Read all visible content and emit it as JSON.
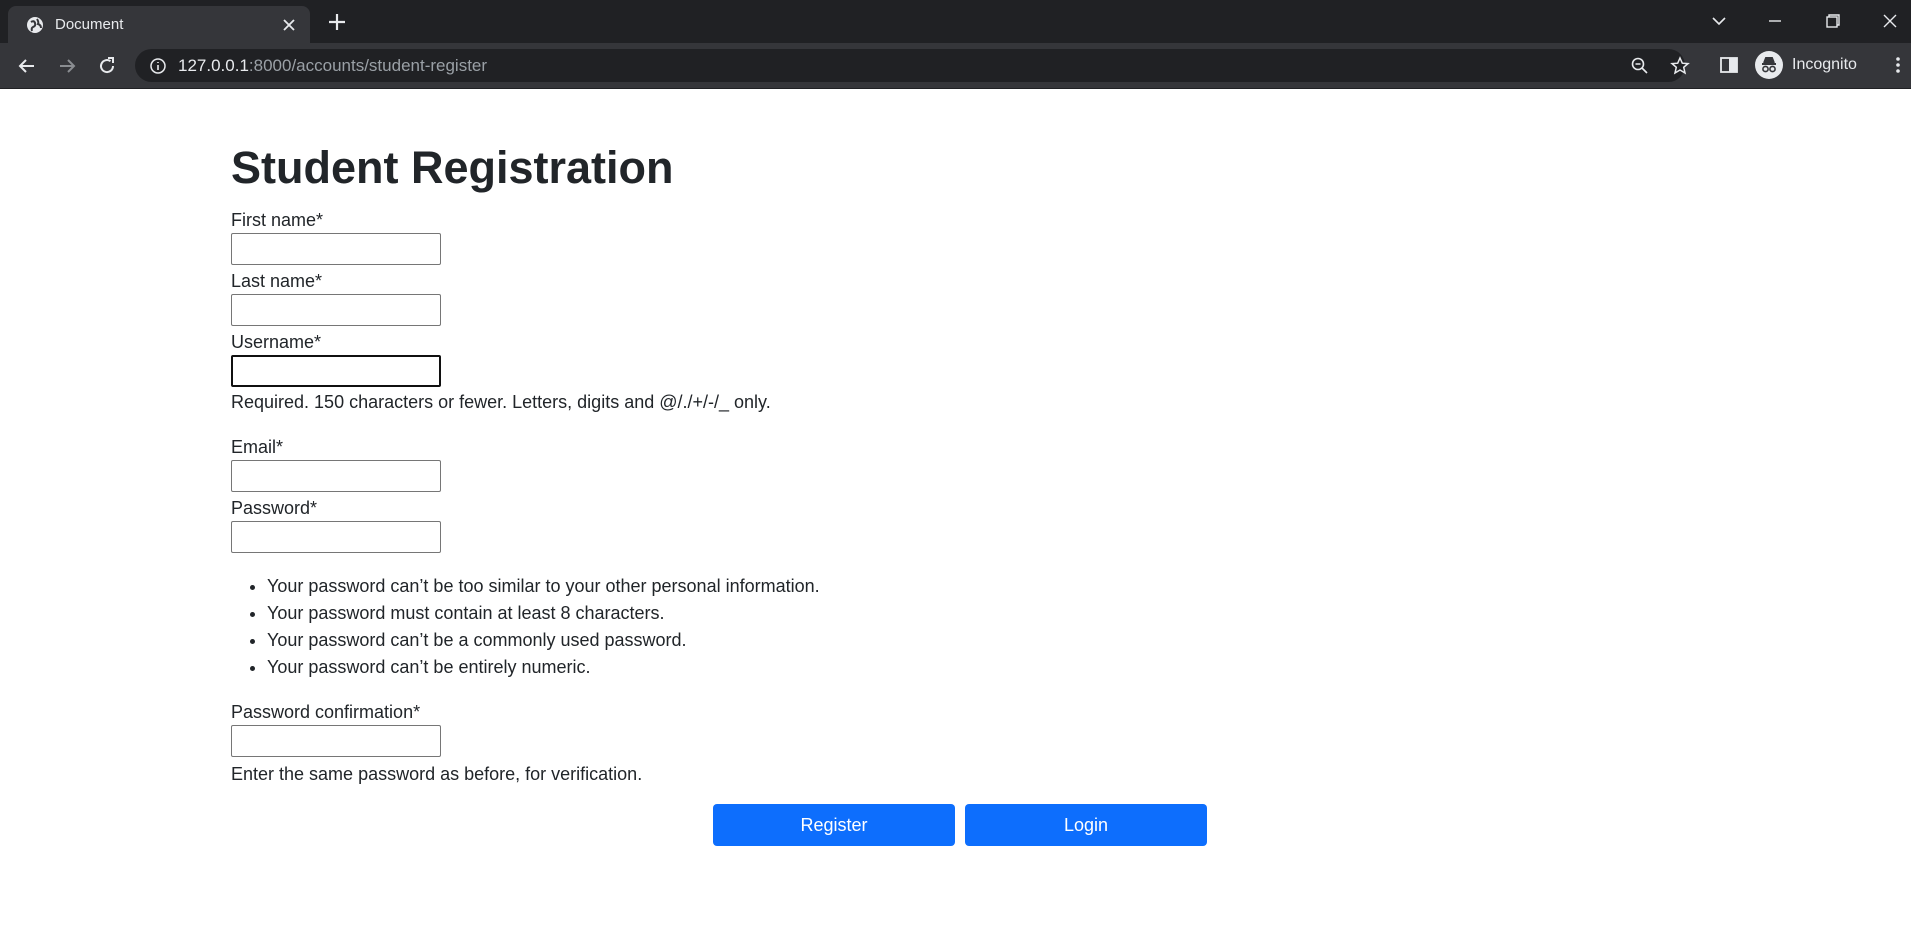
{
  "browser": {
    "tab_title": "Document",
    "url_host": "127.0.0.1",
    "url_path": ":8000/accounts/student-register",
    "profile_label": "Incognito"
  },
  "form": {
    "title": "Student Registration",
    "first_name_label": "First name*",
    "last_name_label": "Last name*",
    "username_label": "Username*",
    "username_help": "Required. 150 characters or fewer. Letters, digits and @/./+/-/_ only.",
    "email_label": "Email*",
    "password_label": "Password*",
    "password_rules": [
      "Your password can’t be too similar to your other personal information.",
      "Your password must contain at least 8 characters.",
      "Your password can’t be a commonly used password.",
      "Your password can’t be entirely numeric."
    ],
    "password_confirm_label": "Password confirmation*",
    "password_confirm_help": "Enter the same password as before, for verification.",
    "register_label": "Register",
    "login_label": "Login"
  },
  "colors": {
    "primary": "#0d6efd",
    "chrome_dark": "#202124",
    "chrome_tab": "#35363a"
  }
}
